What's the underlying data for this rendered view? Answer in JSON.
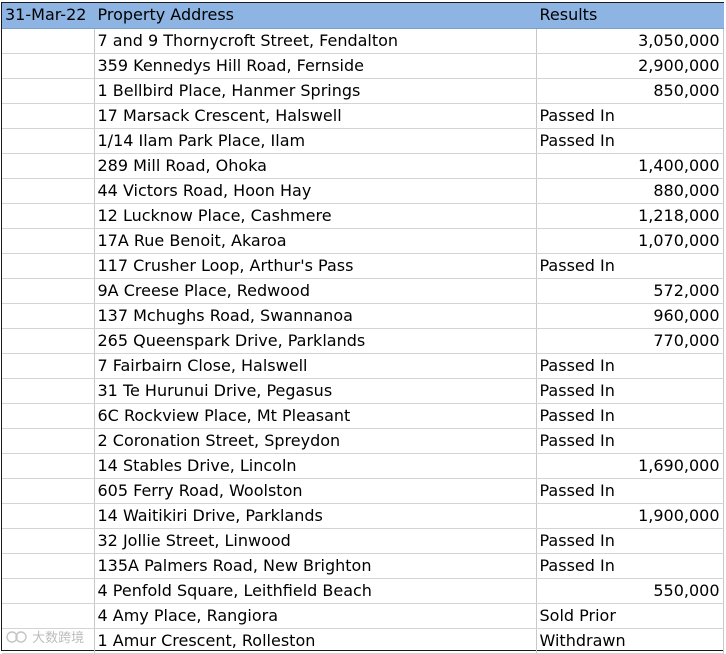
{
  "header": {
    "date": "31-Mar-22",
    "address_col": "Property Address",
    "results_col": "Results"
  },
  "rows": [
    {
      "address": "7 and 9 Thornycroft Street, Fendalton",
      "result": "3,050,000",
      "numeric": true
    },
    {
      "address": "359 Kennedys Hill Road, Fernside",
      "result": "2,900,000",
      "numeric": true
    },
    {
      "address": "1 Bellbird Place, Hanmer Springs",
      "result": "850,000",
      "numeric": true
    },
    {
      "address": "17 Marsack Crescent, Halswell",
      "result": "Passed In",
      "numeric": false
    },
    {
      "address": "1/14 Ilam Park Place, Ilam",
      "result": "Passed In",
      "numeric": false
    },
    {
      "address": "289 Mill Road, Ohoka",
      "result": "1,400,000",
      "numeric": true
    },
    {
      "address": "44 Victors Road, Hoon Hay",
      "result": "880,000",
      "numeric": true
    },
    {
      "address": "12 Lucknow Place, Cashmere",
      "result": "1,218,000",
      "numeric": true
    },
    {
      "address": "17A Rue Benoit, Akaroa",
      "result": "1,070,000",
      "numeric": true
    },
    {
      "address": "117 Crusher Loop, Arthur's Pass",
      "result": "Passed In",
      "numeric": false
    },
    {
      "address": "9A Creese Place, Redwood",
      "result": "572,000",
      "numeric": true
    },
    {
      "address": "137 Mchughs Road, Swannanoa",
      "result": "960,000",
      "numeric": true
    },
    {
      "address": "265 Queenspark Drive, Parklands",
      "result": "770,000",
      "numeric": true
    },
    {
      "address": "7 Fairbairn Close, Halswell",
      "result": "Passed In",
      "numeric": false
    },
    {
      "address": "31 Te Hurunui Drive, Pegasus",
      "result": "Passed In",
      "numeric": false
    },
    {
      "address": "6C Rockview Place, Mt Pleasant",
      "result": "Passed In",
      "numeric": false
    },
    {
      "address": "2 Coronation Street, Spreydon",
      "result": "Passed In",
      "numeric": false
    },
    {
      "address": "14 Stables Drive, Lincoln",
      "result": "1,690,000",
      "numeric": true
    },
    {
      "address": "605 Ferry Road, Woolston",
      "result": "Passed In",
      "numeric": false
    },
    {
      "address": "14 Waitikiri Drive, Parklands",
      "result": "1,900,000",
      "numeric": true
    },
    {
      "address": "32 Jollie Street, Linwood",
      "result": "Passed In",
      "numeric": false
    },
    {
      "address": "135A Palmers Road, New Brighton",
      "result": "Passed In",
      "numeric": false
    },
    {
      "address": "4 Penfold Square, Leithfield Beach",
      "result": "550,000",
      "numeric": true
    },
    {
      "address": "4 Amy Place, Rangiora",
      "result": "Sold Prior",
      "numeric": false
    },
    {
      "address": "1 Amur Crescent, Rolleston",
      "result": "Withdrawn",
      "numeric": false
    }
  ],
  "watermark": "大数跨境",
  "colors": {
    "header_bg": "#8db4e2",
    "grid": "#d4d4d4"
  }
}
